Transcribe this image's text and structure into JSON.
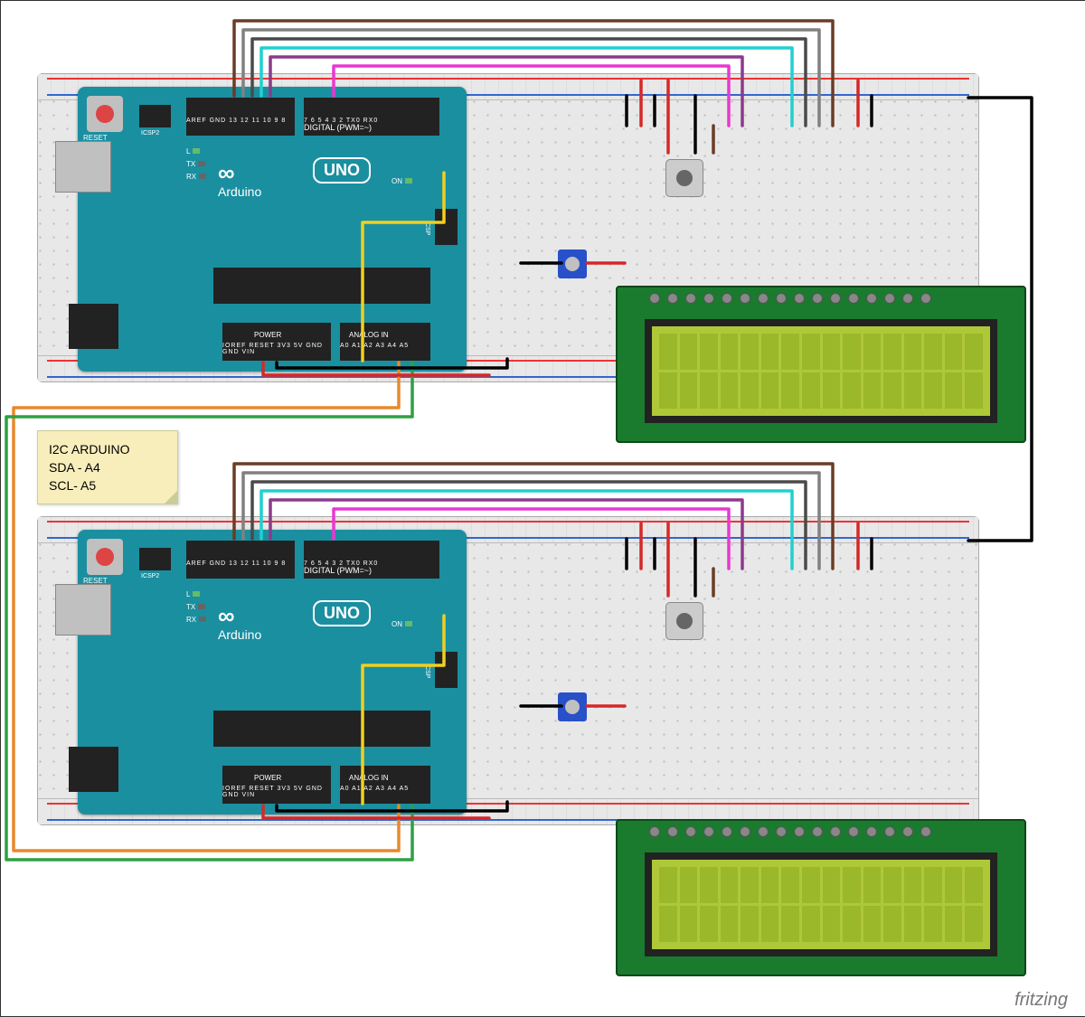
{
  "note": {
    "line1": "I2C ARDUINO",
    "line2": "SDA - A4",
    "line3": "SCL- A5"
  },
  "arduino": {
    "reset": "RESET",
    "icsp_label": "ICSP2",
    "icsp2_label": "ICSP",
    "digital_label": "DIGITAL (PWM=~)",
    "power_label": "POWER",
    "analog_label": "ANALOG IN",
    "logo_infinity": "∞",
    "uno_label": "UNO",
    "brand": "Arduino",
    "led_l": "L",
    "led_tx": "TX",
    "led_rx": "RX",
    "led_on": "ON",
    "top_pins1": "AREF GND 13 12 11 10 9 8",
    "top_pins2": "7 6 5 4 3 2 TX0 RX0",
    "bot_pins1": "IOREF RESET 3V3 5V GND GND VIN",
    "bot_pins2": "A0 A1 A2 A3 A4 A5"
  },
  "watermark": "fritzing",
  "wires": {
    "i2c_sda_color": "#e8892b",
    "i2c_scl_color": "#2ea043",
    "gnd_color": "#000000",
    "5v_color": "#d62828",
    "yellow": "#f0d020",
    "brown": "#6b3c26",
    "gray": "#808080",
    "darkgray": "#4a4a4a",
    "cyan": "#20d0d0",
    "purple": "#8b3a8b",
    "magenta": "#e838d0",
    "black": "#000000",
    "red": "#d62828"
  }
}
